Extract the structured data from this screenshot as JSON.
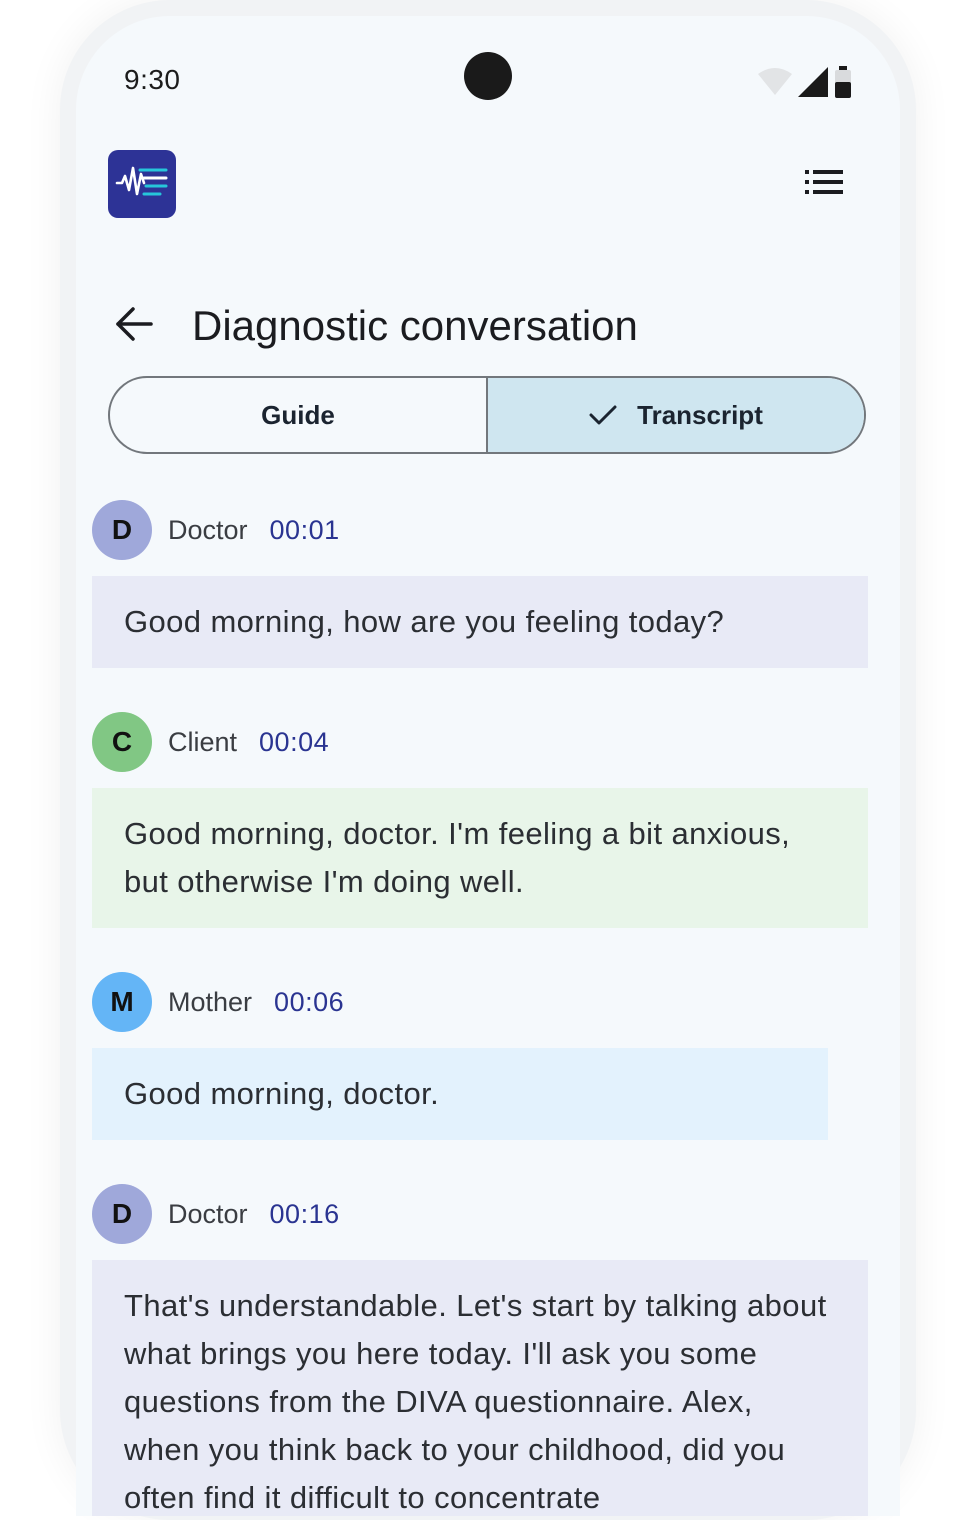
{
  "status_bar": {
    "time": "9:30"
  },
  "header": {
    "logo_icon": "waveform-list-icon",
    "menu_icon": "list-icon"
  },
  "page": {
    "title": "Diagnostic conversation",
    "back_icon": "arrow-left-icon"
  },
  "tabs": [
    {
      "label": "Guide",
      "active": false
    },
    {
      "label": "Transcript",
      "active": true
    }
  ],
  "colors": {
    "accent": "#2d3396",
    "timestamp": "#2a3491",
    "doctor_avatar": "#9fa8da",
    "client_avatar": "#81c784",
    "mother_avatar": "#64b5f6",
    "doctor_bubble": "#e8eaf6",
    "client_bubble": "#e8f5e9",
    "mother_bubble": "#e3f2fd"
  },
  "transcript": [
    {
      "initial": "D",
      "speaker": "Doctor",
      "time": "00:01",
      "text": "Good morning, how are you feeling today?",
      "role": "doctor"
    },
    {
      "initial": "C",
      "speaker": "Client",
      "time": "00:04",
      "text": "Good morning, doctor. I'm feeling a bit anxious, but otherwise I'm doing well.",
      "role": "client"
    },
    {
      "initial": "M",
      "speaker": "Mother",
      "time": "00:06",
      "text": "Good morning, doctor.",
      "role": "mother"
    },
    {
      "initial": "D",
      "speaker": "Doctor",
      "time": "00:16",
      "text": "That's understandable. Let's start by talking about what brings you here today. I'll ask you some questions from the DIVA questionnaire. Alex, when you think back to your childhood, did you often find it difficult to concentrate",
      "role": "doctor"
    }
  ]
}
